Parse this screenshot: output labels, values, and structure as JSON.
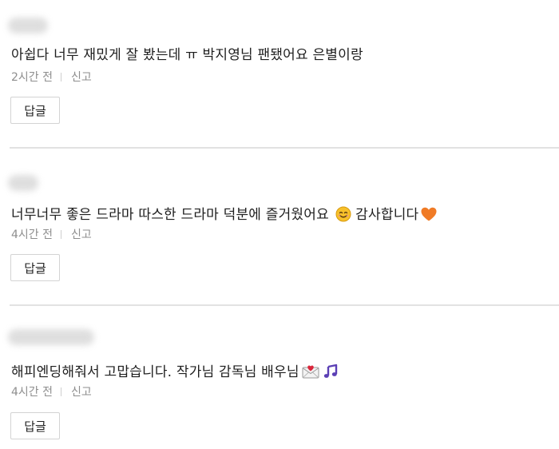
{
  "comments": [
    {
      "text": "아쉽다 너무 재밌게 잘 봤는데 ㅠ 박지영님 팬됐어요 은별이랑",
      "time": "2시간 전",
      "report": "신고",
      "reply": "답글"
    },
    {
      "text": "너무너무 좋은 드라마 따스한 드라마 덕분에 즐거웠어요",
      "text_after": "감사합니다",
      "emojis": [
        "smiling-face-icon",
        "orange-heart-icon"
      ],
      "time": "4시간 전",
      "report": "신고",
      "reply": "답글"
    },
    {
      "text": "해피엔딩해줘서 고맙습니다. 작가님 감독님 배우님",
      "emojis": [
        "love-letter-icon",
        "musical-notes-icon"
      ],
      "time": "4시간 전",
      "report": "신고",
      "reply": "답글"
    }
  ],
  "colors": {
    "text": "#1e1e1e",
    "meta": "#8e8e8e",
    "divider": "#e2e2e2",
    "button_border": "#d3d3d3",
    "heart": "#f07b26",
    "smile": "#f7c02a",
    "music": "#5b3fb5"
  }
}
